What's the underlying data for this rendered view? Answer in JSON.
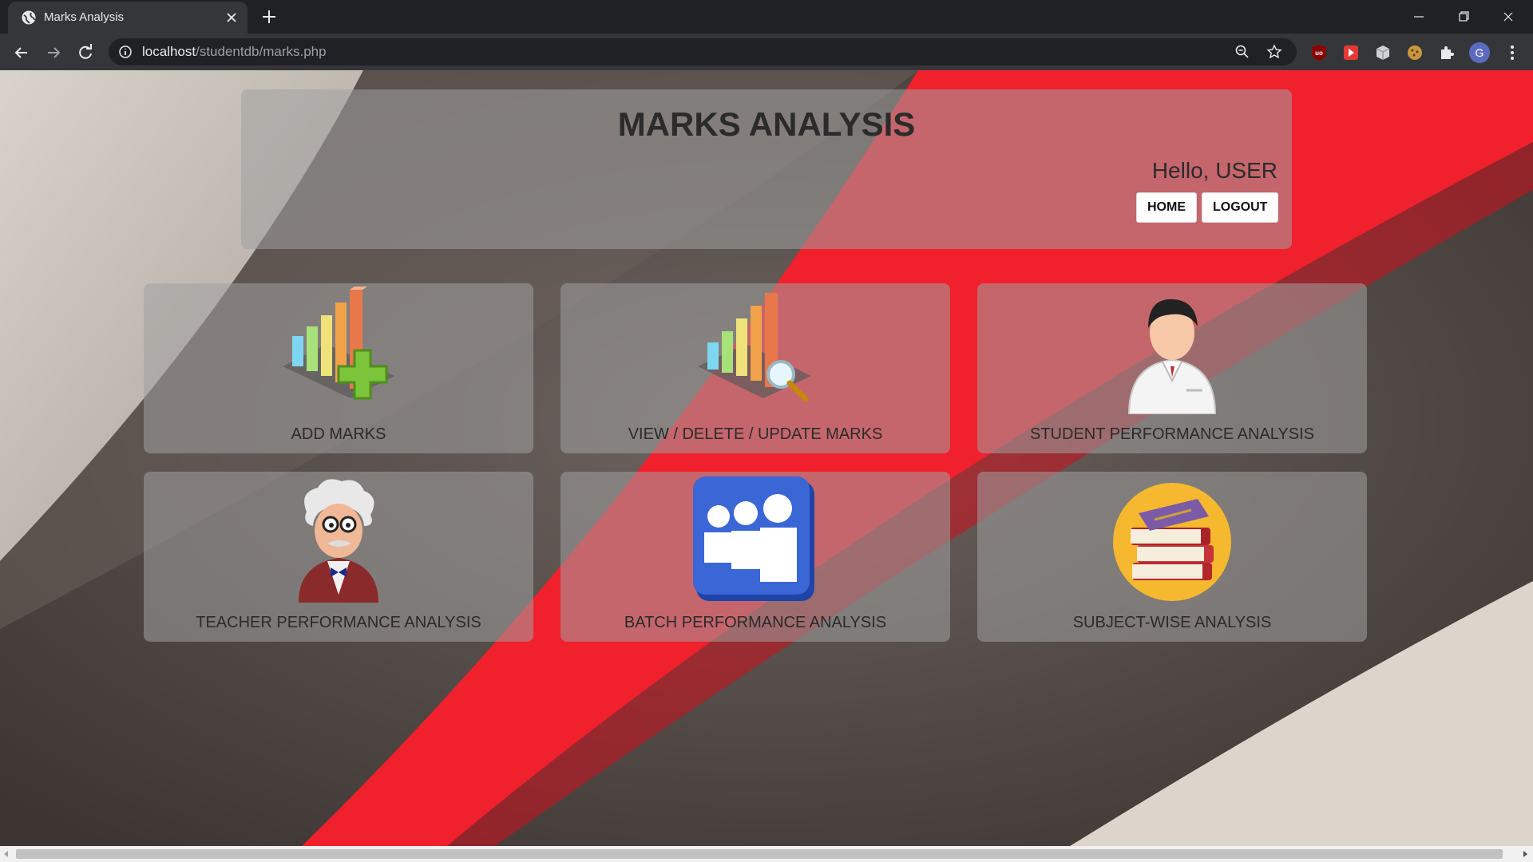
{
  "browser": {
    "tab_title": "Marks Analysis",
    "url_host": "localhost",
    "url_path": "/studentdb/marks.php",
    "profile_initial": "G"
  },
  "header": {
    "title": "MARKS ANALYSIS",
    "greeting": "Hello, USER",
    "home_label": "HOME",
    "logout_label": "LOGOUT"
  },
  "cards": [
    {
      "label": "ADD MARKS",
      "icon": "bar-chart-add-icon"
    },
    {
      "label": "VIEW / DELETE / UPDATE MARKS",
      "icon": "bar-chart-search-icon"
    },
    {
      "label": "STUDENT PERFORMANCE ANALYSIS",
      "icon": "student-avatar-icon"
    },
    {
      "label": "TEACHER PERFORMANCE ANALYSIS",
      "icon": "professor-avatar-icon"
    },
    {
      "label": "BATCH PERFORMANCE ANALYSIS",
      "icon": "group-people-icon"
    },
    {
      "label": "SUBJECT-WISE ANALYSIS",
      "icon": "books-stack-icon"
    }
  ],
  "colors": {
    "accent_red": "#f0202d",
    "background_dark": "#4a4340",
    "panel": "rgba(160,160,160,0.55)"
  }
}
